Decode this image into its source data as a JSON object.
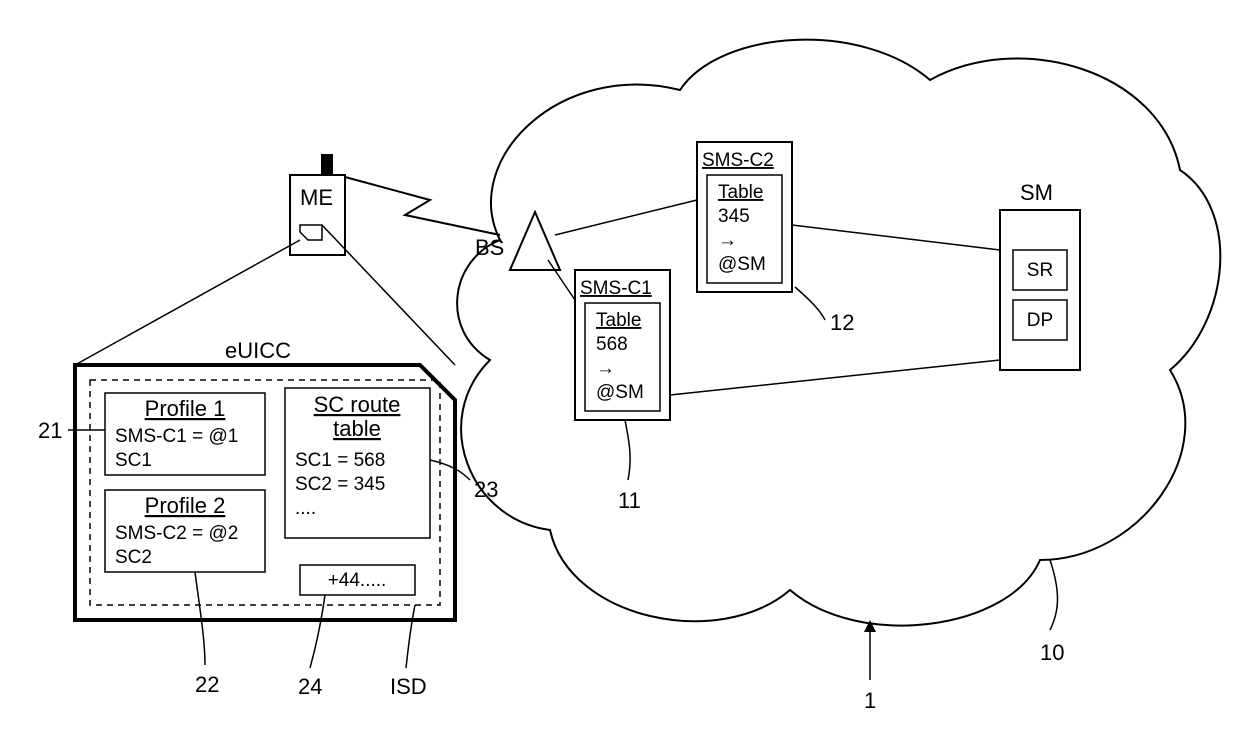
{
  "me": {
    "label": "ME"
  },
  "euicc": {
    "label": "eUICC",
    "profile1": {
      "title": "Profile 1",
      "line1": "SMS-C1 = @1",
      "line2": "SC1",
      "ref": "21"
    },
    "profile2": {
      "title": "Profile 2",
      "line1": "SMS-C2 = @2",
      "line2": "SC2",
      "ref": "22"
    },
    "scroute": {
      "title1": "SC route",
      "title2": "table",
      "line1": "SC1 = 568",
      "line2": "SC2 = 345",
      "line3": "....",
      "ref": "23"
    },
    "phone": {
      "value": "+44.....",
      "ref": "24"
    },
    "isd": {
      "label": "ISD"
    }
  },
  "bs": {
    "label": "BS"
  },
  "cloud": {
    "ref": "10"
  },
  "smsc1": {
    "label": "SMS-C1",
    "table_title": "Table",
    "line1": "568",
    "line2": "→",
    "line3": "@SM",
    "ref": "11"
  },
  "smsc2": {
    "label": "SMS-C2",
    "table_title": "Table",
    "line1": "345",
    "line2": "→",
    "line3": "@SM",
    "ref": "12"
  },
  "sm": {
    "label": "SM",
    "sr": "SR",
    "dp": "DP"
  },
  "overall": {
    "ref": "1"
  }
}
